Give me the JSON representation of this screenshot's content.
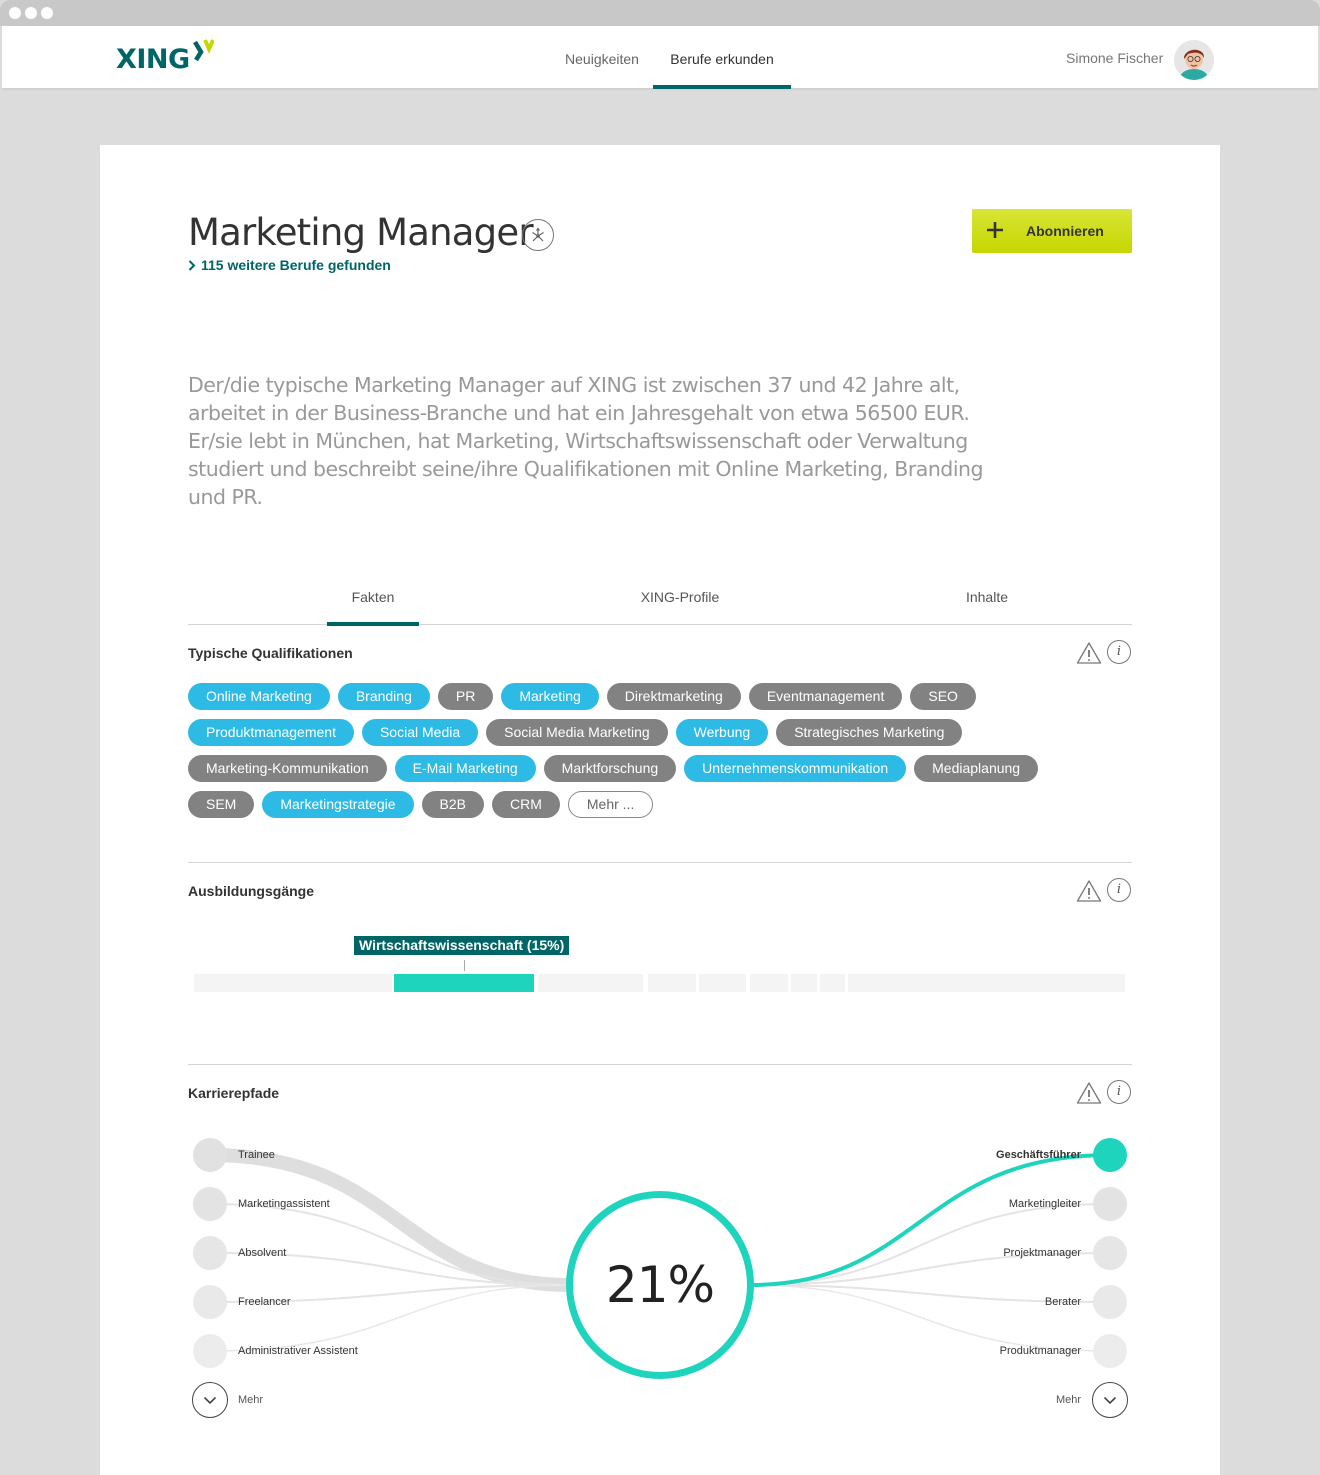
{
  "app": {
    "logo_text": "XING",
    "nav": {
      "tabs": [
        "Neuigkeiten",
        "Berufe erkunden"
      ],
      "active_tab": "Berufe erkunden"
    },
    "user": {
      "name": "Simone Fischer"
    }
  },
  "header": {
    "title": "Marketing Manager",
    "more_jobs": "115 weitere Berufe gefunden",
    "subscribe_label": "Abonnieren"
  },
  "description": "Der/die typische Marketing Manager auf XING ist zwischen 37 und 42 Jahre alt, arbeitet in der Business-Branche und hat ein Jahresgehalt von etwa 56500 EUR. Er/sie lebt in München, hat Marketing, Wirtschaftswissenschaft oder Verwaltung studiert und beschreibt seine/ihre Qualifikationen mit Online Marketing, Branding und PR.",
  "tabs": {
    "items": [
      "Fakten",
      "XING-Profile",
      "Inhalte"
    ],
    "active": "Fakten"
  },
  "qualifications": {
    "title": "Typische Qualifikationen",
    "rows": [
      [
        {
          "label": "Online Marketing",
          "highlight": true
        },
        {
          "label": "Branding",
          "highlight": true
        },
        {
          "label": "PR",
          "highlight": false
        },
        {
          "label": "Marketing",
          "highlight": true
        },
        {
          "label": "Direktmarketing",
          "highlight": false
        },
        {
          "label": "Eventmanagement",
          "highlight": false
        },
        {
          "label": "SEO",
          "highlight": false
        }
      ],
      [
        {
          "label": "Produktmanagement",
          "highlight": true
        },
        {
          "label": "Social Media",
          "highlight": true
        },
        {
          "label": "Social Media Marketing",
          "highlight": false
        },
        {
          "label": "Werbung",
          "highlight": true
        },
        {
          "label": "Strategisches Marketing",
          "highlight": false
        }
      ],
      [
        {
          "label": "Marketing-Kommunikation",
          "highlight": false
        },
        {
          "label": "E-Mail Marketing",
          "highlight": true
        },
        {
          "label": "Marktforschung",
          "highlight": false
        },
        {
          "label": "Unternehmenskommunikation",
          "highlight": true
        },
        {
          "label": "Mediaplanung",
          "highlight": false
        }
      ],
      [
        {
          "label": "SEM",
          "highlight": false
        },
        {
          "label": "Marketingstrategie",
          "highlight": true
        },
        {
          "label": "B2B",
          "highlight": false
        },
        {
          "label": "CRM",
          "highlight": false
        }
      ]
    ],
    "more_label": "Mehr ..."
  },
  "education": {
    "title": "Ausbildungsgänge",
    "highlight_label": "Wirtschaftswissenschaft (15%)",
    "highlight_share": 0.15
  },
  "career": {
    "title": "Karrierepfade",
    "percent": "21%",
    "previous": [
      "Trainee",
      "Marketingassistent",
      "Absolvent",
      "Freelancer",
      "Administrativer Assistent"
    ],
    "next": [
      "Geschäftsführer",
      "Marketingleiter",
      "Projektmanager",
      "Berater",
      "Produktmanager"
    ],
    "more_label": "Mehr",
    "accent_color": "#1fd4bd"
  },
  "colors": {
    "brand": "#006567",
    "tag_blue": "#2dbbe6",
    "tag_grey": "#828282",
    "subscribe": "#c6d600"
  }
}
